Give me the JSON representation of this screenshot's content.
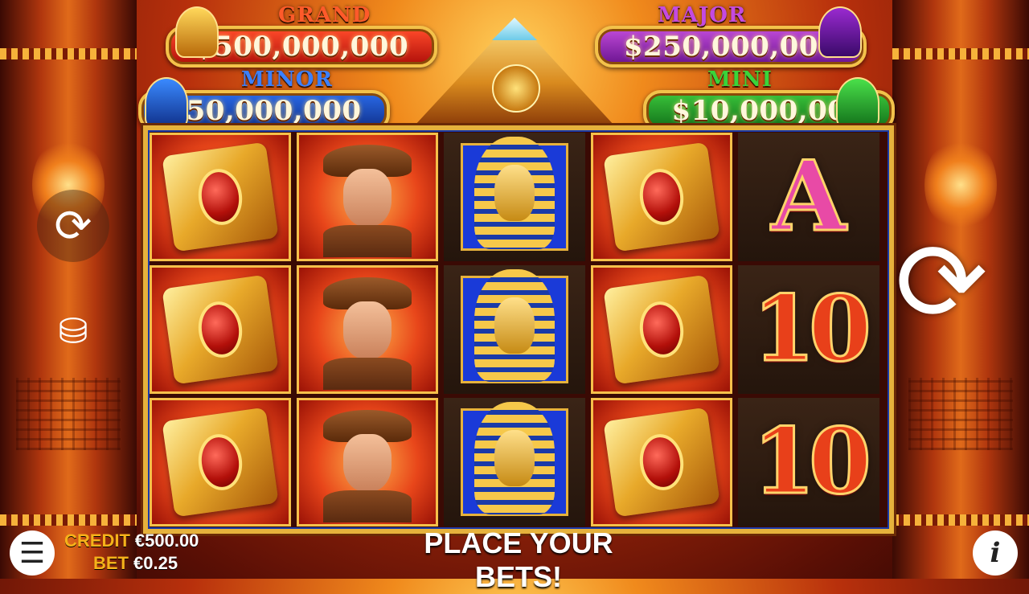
{
  "jackpots": {
    "grand": {
      "title": "GRAND",
      "amount": "$500,000,000",
      "title_color": "#ff4a2a"
    },
    "major": {
      "title": "MAJOR",
      "amount": "$250,000,000",
      "title_color": "#b83ad8"
    },
    "minor": {
      "title": "MINOR",
      "amount": "$50,000,000",
      "title_color": "#3a7aff"
    },
    "mini": {
      "title": "MINI",
      "amount": "$10,000,000",
      "title_color": "#3ad43a"
    }
  },
  "reels": [
    [
      "scarab-book",
      "scarab-book",
      "scarab-book"
    ],
    [
      "explorer",
      "explorer",
      "explorer"
    ],
    [
      "pharaoh",
      "pharaoh",
      "pharaoh"
    ],
    [
      "scarab-book",
      "scarab-book",
      "scarab-book"
    ],
    [
      "A",
      "10",
      "10"
    ]
  ],
  "controls": {
    "autoplay_icon": "autoplay-icon",
    "bet_icon": "coins-icon",
    "spin_icon": "spin-icon",
    "menu_icon": "hamburger-menu-icon",
    "info_icon": "info-icon",
    "info_glyph": "i"
  },
  "status": {
    "credit_label": "CREDIT",
    "credit_value": "€500.00",
    "bet_label": "BET",
    "bet_value": "€0.25",
    "message": "PLACE YOUR BETS!"
  }
}
